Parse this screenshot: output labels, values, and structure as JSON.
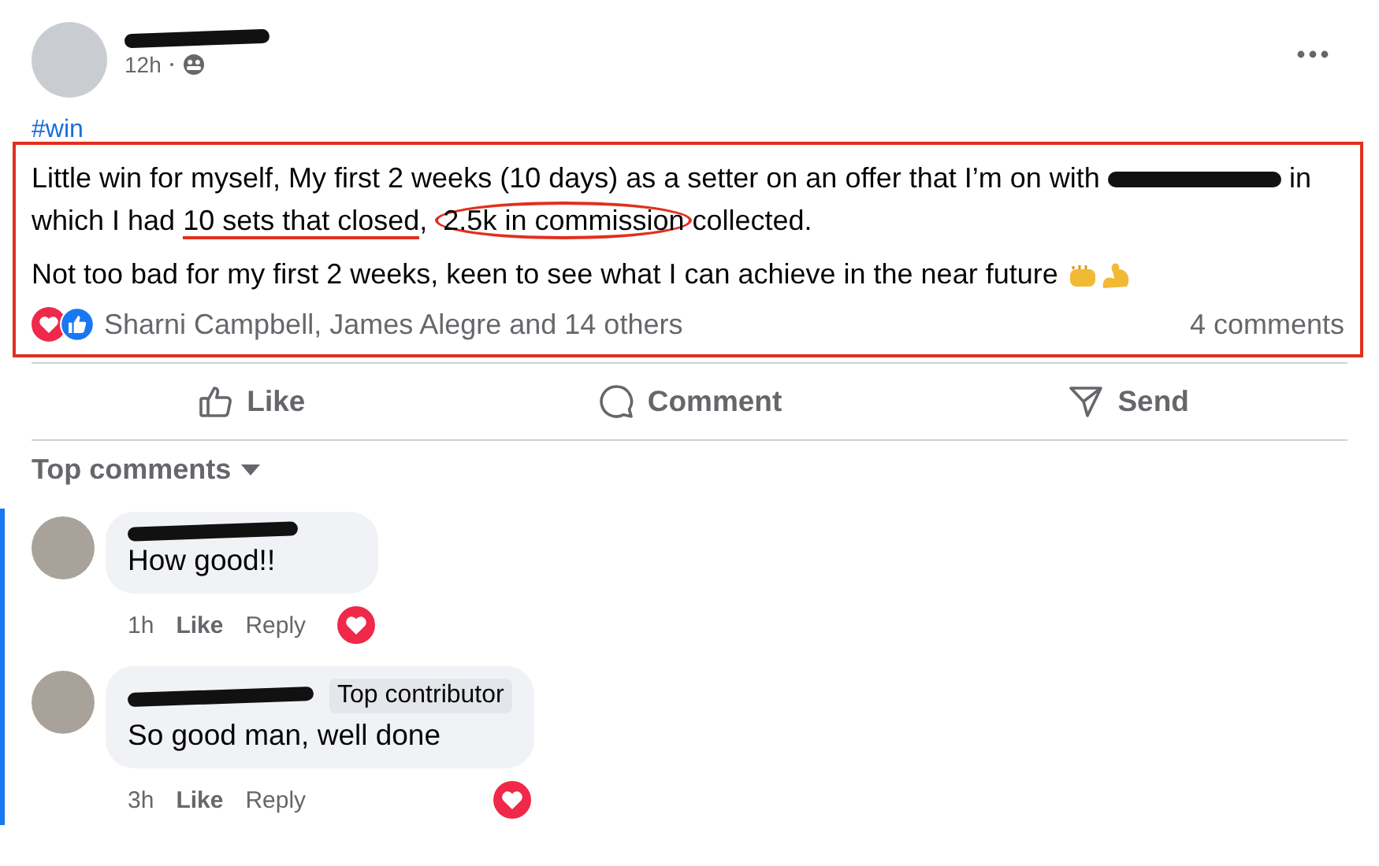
{
  "post": {
    "time": "12h",
    "hashtag": "#win",
    "paragraphs": [
      [
        {
          "kind": "plain",
          "text": "Little win for myself, My first 2 weeks (10 days) as a setter on an offer that I’m on with "
        },
        {
          "kind": "redacted"
        },
        {
          "kind": "plain",
          "text": " in which I had "
        },
        {
          "kind": "underlined",
          "text": "10 sets that closed"
        },
        {
          "kind": "plain",
          "text": ", "
        },
        {
          "kind": "circled",
          "text": "2.5k in commission"
        },
        {
          "kind": "plain",
          "text": "collected."
        }
      ],
      [
        {
          "kind": "plain",
          "text": "Not too bad for my first 2 weeks, keen to see what I can achieve in the near future"
        }
      ]
    ],
    "reaction_names": "Sharni Campbell, James Alegre and 14 others",
    "comment_count": "4 comments"
  },
  "actions": [
    {
      "kind": "like",
      "label": "Like"
    },
    {
      "kind": "comment",
      "label": "Comment"
    },
    {
      "kind": "send",
      "label": "Send"
    }
  ],
  "comments_filter": "Top comments",
  "comments": [
    {
      "text": "How good!!",
      "time": "1h",
      "like": "Like",
      "reply": "Reply"
    },
    {
      "badge": "Top contributor",
      "text": "So good man, well done",
      "time": "3h",
      "like": "Like",
      "reply": "Reply"
    }
  ]
}
